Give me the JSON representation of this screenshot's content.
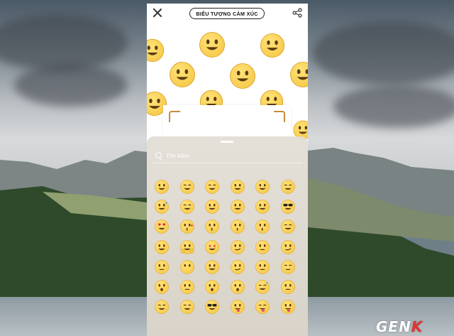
{
  "header": {
    "title": "BIỂU TƯỢNG CẢM XÚC",
    "close_icon": "close-icon",
    "share_icon": "share-icon"
  },
  "search": {
    "placeholder": "Tìm kiếm",
    "value": ""
  },
  "emoji_grid": [
    [
      "grinning",
      "smiling-eyes",
      "beaming-grin",
      "zany-face",
      "grinning",
      "smiling-eyes"
    ],
    [
      "sweat-smile",
      "laughing",
      "wink",
      "blush",
      "savoring",
      "sunglasses"
    ],
    [
      "heart-eyes",
      "kissing-heart",
      "kissing",
      "kissing-face",
      "kissing-closed-eyes",
      "relieved"
    ],
    [
      "slight-smile",
      "hugging",
      "star-struck",
      "thinking",
      "neutral",
      "raised-eyebrow"
    ],
    [
      "expressionless",
      "no-mouth",
      "rolling-eyes",
      "smirk",
      "persevere",
      "disappointed-relieved"
    ],
    [
      "hushed",
      "zipper-mouth",
      "astonished",
      "surprised",
      "sleepy-sweat",
      "weary"
    ],
    [
      "sleeping",
      "relieved-sigh",
      "nerd",
      "tongue",
      "squint-tongue",
      "tongue-wink"
    ]
  ],
  "watermark": {
    "text": "GEN",
    "accent": "K"
  },
  "colors": {
    "emoji_yellow": "#f7c948",
    "emoji_dark": "#5a3b12",
    "accent_orange": "#c98a3a"
  }
}
